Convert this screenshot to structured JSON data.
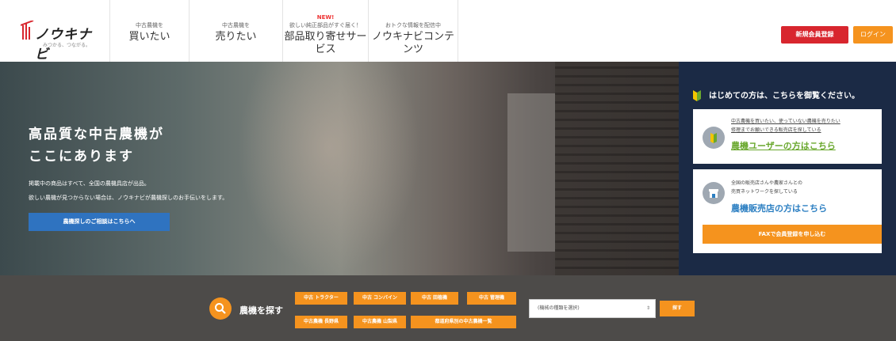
{
  "header": {
    "logo_text": "ノウキナビ",
    "logo_sub": "みつかる、つながる。",
    "nav": [
      {
        "small": "中古農機を",
        "big": "買いたい",
        "new": ""
      },
      {
        "small": "中古農機を",
        "big": "売りたい",
        "new": ""
      },
      {
        "small": "欲しい純正部品がすぐ届く！",
        "big": "部品取り寄せサービス",
        "new": "NEW!"
      },
      {
        "small": "おトクな情報を配信中",
        "big": "ノウキナビコンテンツ",
        "new": ""
      }
    ],
    "register": "新規会員登録",
    "login": "ログイン"
  },
  "hero": {
    "title_line1": "高品質な中古農機が",
    "title_line2": "ここにあります",
    "desc_line1": "掲載中の商品はすべて、全国の農機具店が出品。",
    "desc_line2": "欲しい農機が見つからない場合は、ノウキナビが農機探しのお手伝いをします。",
    "button": "農機探しのご相談はこちらへ"
  },
  "side": {
    "heading": "はじめての方は、こちらを御覧ください。",
    "card1": {
      "line1": "中古農機を買いたい、使っていない農機を売りたい",
      "line2": "修理までお願いできる販売店を探している",
      "cta": "農機ユーザーの方はこちら"
    },
    "card2": {
      "line1": "全国の販売店さんや農家さんとの",
      "line2": "売買ネットワークを探している",
      "cta": "農機販売店の方はこちら",
      "fax": "FAXで会員登録を申し込む"
    }
  },
  "search": {
    "label": "農機を探す",
    "tags_row1": [
      "中古 トラクター",
      "中古 コンバイン",
      "中古 田植機",
      "中古 管理機"
    ],
    "tags_row2": [
      "中古農機 長野県",
      "中古農機 山梨県",
      "都道府県別の中古農機一覧"
    ],
    "select_value": "(機械の種類を選択)",
    "button": "探す"
  },
  "colors": {
    "accent": "#f5931e",
    "register": "#d8262e",
    "side_bg": "#1b2a45",
    "search_bg": "#4d4b49",
    "user_cta": "#6aa82e",
    "dealer_cta": "#2c7fc2"
  }
}
